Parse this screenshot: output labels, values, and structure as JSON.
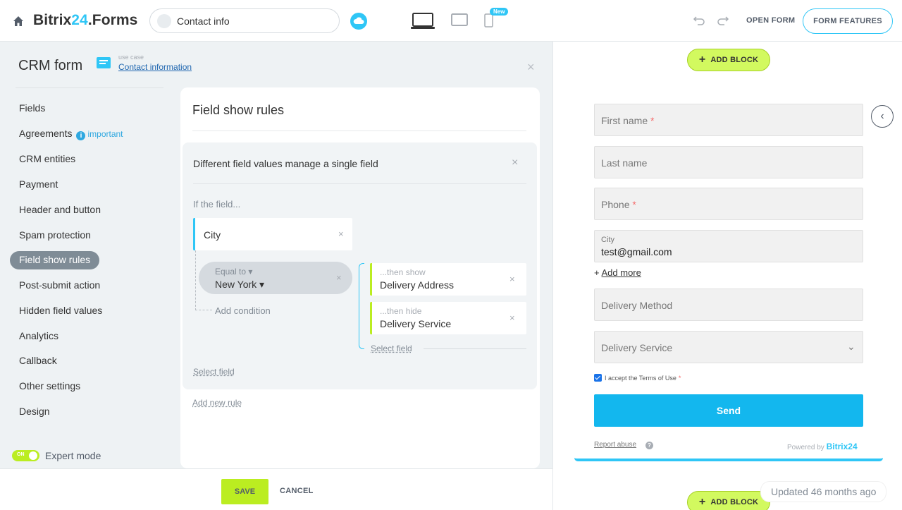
{
  "topbar": {
    "logo_main": "Bitrix",
    "logo_hl": "24",
    "logo_suffix": ".Forms",
    "form_name": "Contact info",
    "new_badge": "New",
    "open_form": "OPEN FORM",
    "form_features": "FORM FEATURES"
  },
  "panel": {
    "title": "CRM form",
    "usecase_small": "use case",
    "usecase_link": "Contact information",
    "close": "×"
  },
  "nav": {
    "items": [
      {
        "label": "Fields"
      },
      {
        "label": "Agreements"
      },
      {
        "label": "CRM entities"
      },
      {
        "label": "Payment"
      },
      {
        "label": "Header and button"
      },
      {
        "label": "Spam protection"
      },
      {
        "label": "Field show rules"
      },
      {
        "label": "Post-submit action"
      },
      {
        "label": "Hidden field values"
      },
      {
        "label": "Analytics"
      },
      {
        "label": "Callback"
      },
      {
        "label": "Other settings"
      },
      {
        "label": "Design"
      }
    ],
    "important": "important",
    "info_glyph": "i",
    "active_index": 6,
    "expert_toggle_text": "ON",
    "expert_label": "Expert mode"
  },
  "rules": {
    "title": "Field show rules",
    "rule_title": "Different field values manage a single field",
    "close": "×",
    "if_label": "If the field...",
    "field": "City",
    "condition_op": "Equal to",
    "condition_val": "New York",
    "add_condition": "Add condition",
    "actions": [
      {
        "label": "...then show",
        "field": "Delivery Address"
      },
      {
        "label": "...then hide",
        "field": "Delivery Service"
      }
    ],
    "select_field_right": "Select field",
    "select_field_left": "Select field",
    "add_rule": "Add new rule"
  },
  "footer": {
    "save": "SAVE",
    "cancel": "CANCEL"
  },
  "preview": {
    "add_block": "ADD BLOCK",
    "fields": {
      "first_name": "First name",
      "last_name": "Last name",
      "phone": "Phone",
      "city_label": "City",
      "city_value": "test@gmail.com",
      "delivery_method": "Delivery Method",
      "delivery_service": "Delivery Service"
    },
    "required_mark": "*",
    "add_more": "Add more",
    "terms": "I accept the Terms of Use",
    "send": "Send",
    "report_abuse": "Report abuse",
    "help_glyph": "?",
    "powered_by": "Powered by",
    "brand": "Bitrix24",
    "updated": "Updated 46 months ago"
  },
  "colors": {
    "accent": "#2fc6f6",
    "lime": "#bbed21",
    "send": "#13b7ee"
  }
}
